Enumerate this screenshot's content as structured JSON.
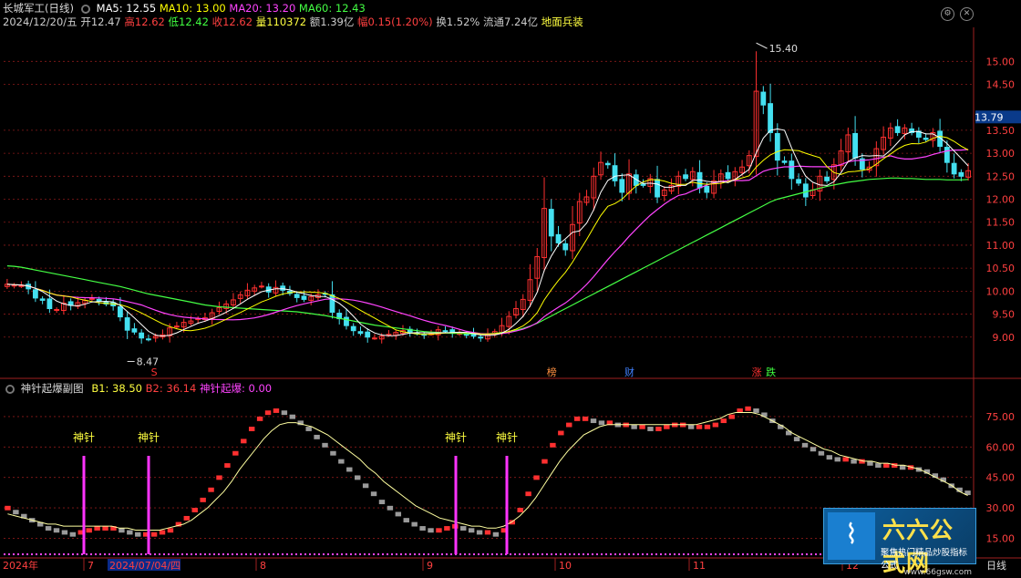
{
  "header": {
    "title": "长城军工(日线)",
    "ma5_label": "MA5: 12.55",
    "ma10_label": "MA10: 13.00",
    "ma20_label": "MA20: 13.20",
    "ma60_label": "MA60: 12.43"
  },
  "info": {
    "date": "2024/12/20/五",
    "open": "开12.47",
    "high": "高12.62",
    "low": "低12.42",
    "close": "收12.62",
    "volume": "量110372",
    "amount": "额1.39亿",
    "change": "幅0.15(1.20%)",
    "turnover": "换1.52%",
    "float": "流通7.24亿",
    "sector": "地面兵装"
  },
  "sub_header": {
    "title": "神针起爆副图",
    "b1": "B1: 38.50",
    "b2": "B2: 36.14",
    "trigger": "神针起爆: 0.00"
  },
  "x_axis": {
    "labels": [
      "2024年",
      "7",
      "2024/07/04/四",
      "8",
      "9",
      "10",
      "11",
      "12",
      "日线"
    ]
  },
  "colors": {
    "up": "#ff3030",
    "down": "#44e0f0",
    "ma5": "#ffffff",
    "ma10": "#ffff00",
    "ma20": "#ff44ff",
    "ma60": "#44ff44",
    "grid": "#8a1a1a",
    "spike": "#ff33ff",
    "bar_down": "#9a9a9a"
  },
  "chart_data": [
    {
      "type": "candlestick",
      "title": "长城军工(日线)",
      "y_ticks": [
        "15.00",
        "14.50",
        "13.50",
        "13.00",
        "12.50",
        "12.00",
        "11.50",
        "11.00",
        "10.50",
        "10.00",
        "9.50",
        "9.00"
      ],
      "ylim": [
        8.4,
        15.7
      ],
      "current_price": "13.79",
      "annotations": {
        "max_label": "15.40",
        "min_label": "8.47",
        "events": [
          "S",
          "榜",
          "财",
          "涨",
          "跌"
        ]
      },
      "closes": [
        10.15,
        10.13,
        10.12,
        10.05,
        9.85,
        9.8,
        9.62,
        9.6,
        9.74,
        9.69,
        9.75,
        9.8,
        9.84,
        9.78,
        9.72,
        9.68,
        9.44,
        9.15,
        9.11,
        8.98,
        8.95,
        9.02,
        9.05,
        9.2,
        9.24,
        9.32,
        9.35,
        9.4,
        9.42,
        9.53,
        9.64,
        9.72,
        9.81,
        9.92,
        10.02,
        10.07,
        10.11,
        9.98,
        10.08,
        10.02,
        9.95,
        9.86,
        9.82,
        9.88,
        9.92,
        9.94,
        9.54,
        9.4,
        9.25,
        9.14,
        9.08,
        9.0,
        8.98,
        9.02,
        9.06,
        9.1,
        9.14,
        9.11,
        9.08,
        9.04,
        9.07,
        9.16,
        9.13,
        9.09,
        9.08,
        9.05,
        9.02,
        8.98,
        9.05,
        9.12,
        9.25,
        9.45,
        9.62,
        9.82,
        10.25,
        10.75,
        11.8,
        11.2,
        11.05,
        10.9,
        11.45,
        11.95,
        12.05,
        12.5,
        12.8,
        12.75,
        12.4,
        12.15,
        12.55,
        12.3,
        12.3,
        12.45,
        12.05,
        12.2,
        12.3,
        12.5,
        12.45,
        12.6,
        12.25,
        12.15,
        12.4,
        12.55,
        12.45,
        12.6,
        12.7,
        12.95,
        14.35,
        14.05,
        13.45,
        12.85,
        12.8,
        12.45,
        12.35,
        12.05,
        12.2,
        12.5,
        12.4,
        12.75,
        13.05,
        13.4,
        12.9,
        12.65,
        12.7,
        13.1,
        13.35,
        13.55,
        13.45,
        13.55,
        13.45,
        13.35,
        13.3,
        13.45,
        13.15,
        12.8,
        12.55,
        12.5,
        12.62
      ],
      "ma60": [
        10.55,
        10.54,
        10.52,
        10.49,
        10.46,
        10.43,
        10.4,
        10.37,
        10.34,
        10.31,
        10.28,
        10.25,
        10.22,
        10.19,
        10.16,
        10.13,
        10.1,
        10.06,
        10.02,
        9.98,
        9.94,
        9.91,
        9.88,
        9.85,
        9.82,
        9.79,
        9.76,
        9.73,
        9.7,
        9.68,
        9.66,
        9.65,
        9.64,
        9.63,
        9.62,
        9.61,
        9.6,
        9.59,
        9.58,
        9.57,
        9.56,
        9.55,
        9.53,
        9.51,
        9.49,
        9.47,
        9.44,
        9.41,
        9.38,
        9.35,
        9.32,
        9.29,
        9.26,
        9.24,
        9.22,
        9.2,
        9.18,
        9.16,
        9.14,
        9.12,
        9.11,
        9.1,
        9.09,
        9.08,
        9.08,
        9.07,
        9.07,
        9.07,
        9.07,
        9.08,
        9.1,
        9.12,
        9.15,
        9.19,
        9.24,
        9.3,
        9.38,
        9.46,
        9.54,
        9.62,
        9.7,
        9.78,
        9.86,
        9.94,
        10.02,
        10.1,
        10.18,
        10.26,
        10.34,
        10.42,
        10.5,
        10.58,
        10.66,
        10.74,
        10.82,
        10.9,
        10.98,
        11.06,
        11.14,
        11.22,
        11.3,
        11.38,
        11.46,
        11.54,
        11.62,
        11.7,
        11.78,
        11.86,
        11.94,
        12.0,
        12.04,
        12.08,
        12.12,
        12.16,
        12.2,
        12.24,
        12.28,
        12.31,
        12.34,
        12.37,
        12.39,
        12.41,
        12.43,
        12.44,
        12.45,
        12.46,
        12.46,
        12.45,
        12.45,
        12.44,
        12.43,
        12.43,
        12.43,
        12.42,
        12.42,
        12.42,
        12.43
      ]
    },
    {
      "type": "bar",
      "title": "神针起爆副图",
      "y_ticks": [
        "75.00",
        "60.00",
        "45.00",
        "30.00",
        "15.00"
      ],
      "ylim": [
        8,
        88
      ],
      "B1": [
        31,
        29,
        27,
        25,
        23,
        21,
        20,
        19,
        18,
        19,
        20,
        21,
        21,
        21,
        20,
        19,
        18,
        18,
        18,
        19,
        20,
        23,
        26,
        30,
        35,
        40,
        46,
        52,
        58,
        64,
        70,
        75,
        78,
        79,
        78,
        76,
        73,
        70,
        66,
        62,
        58,
        54,
        50,
        46,
        42,
        38,
        34,
        31,
        28,
        25,
        23,
        21,
        20,
        20,
        21,
        22,
        21,
        20,
        19,
        19,
        18,
        20,
        24,
        30,
        38,
        46,
        54,
        62,
        68,
        72,
        75,
        75,
        74,
        73,
        73,
        72,
        72,
        71,
        71,
        70,
        70,
        71,
        72,
        72,
        71,
        71,
        71,
        72,
        74,
        76,
        79,
        80,
        79,
        77,
        74,
        71,
        68,
        65,
        62,
        60,
        58,
        56,
        55,
        55,
        54,
        54,
        53,
        52,
        52,
        52,
        51,
        51,
        50,
        49,
        47,
        45,
        42,
        40,
        38.5
      ],
      "B2": [
        27,
        26,
        25,
        24,
        23,
        22,
        22,
        21,
        21,
        21,
        21,
        21,
        21,
        21,
        20,
        20,
        19,
        19,
        19,
        19,
        20,
        21,
        22,
        24,
        27,
        30,
        34,
        38,
        43,
        49,
        54,
        59,
        64,
        68,
        71,
        72,
        72,
        71,
        70,
        68,
        66,
        63,
        60,
        57,
        54,
        50,
        47,
        43,
        40,
        37,
        34,
        31,
        29,
        27,
        25,
        24,
        23,
        22,
        21,
        21,
        20,
        20,
        21,
        23,
        26,
        30,
        35,
        41,
        47,
        53,
        58,
        62,
        66,
        68,
        70,
        71,
        71,
        71,
        71,
        71,
        71,
        71,
        71,
        71,
        71,
        71,
        71,
        72,
        73,
        74,
        76,
        77,
        77,
        77,
        76,
        74,
        72,
        70,
        67,
        65,
        63,
        61,
        59,
        58,
        56,
        55,
        54,
        53,
        53,
        52,
        52,
        51,
        51,
        50,
        49,
        47,
        45,
        43,
        41,
        38,
        36.1
      ],
      "spikes": [
        "神针",
        "神针",
        "神针",
        "神针"
      ]
    }
  ]
}
